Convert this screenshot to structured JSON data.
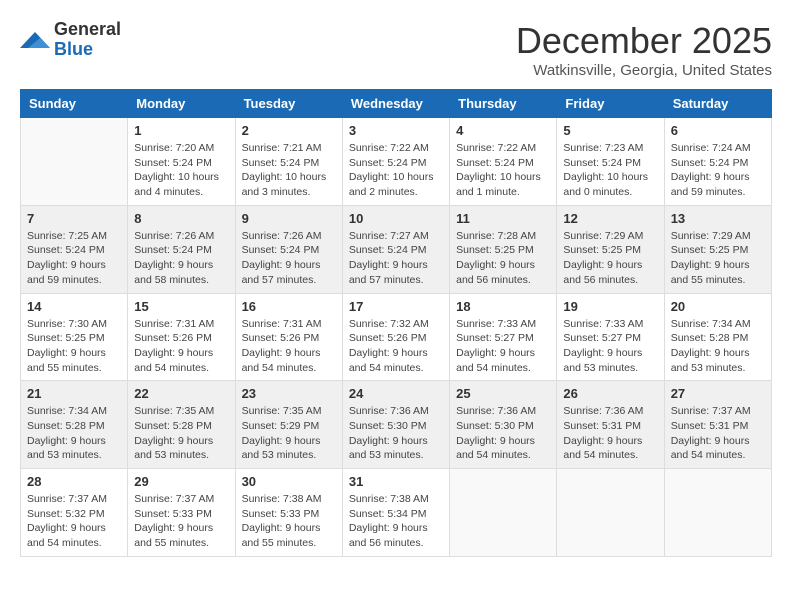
{
  "logo": {
    "general": "General",
    "blue": "Blue"
  },
  "title": "December 2025",
  "location": "Watkinsville, Georgia, United States",
  "weekdays": [
    "Sunday",
    "Monday",
    "Tuesday",
    "Wednesday",
    "Thursday",
    "Friday",
    "Saturday"
  ],
  "weeks": [
    [
      {
        "day": "",
        "empty": true
      },
      {
        "day": "1",
        "sunrise": "Sunrise: 7:20 AM",
        "sunset": "Sunset: 5:24 PM",
        "daylight": "Daylight: 10 hours and 4 minutes."
      },
      {
        "day": "2",
        "sunrise": "Sunrise: 7:21 AM",
        "sunset": "Sunset: 5:24 PM",
        "daylight": "Daylight: 10 hours and 3 minutes."
      },
      {
        "day": "3",
        "sunrise": "Sunrise: 7:22 AM",
        "sunset": "Sunset: 5:24 PM",
        "daylight": "Daylight: 10 hours and 2 minutes."
      },
      {
        "day": "4",
        "sunrise": "Sunrise: 7:22 AM",
        "sunset": "Sunset: 5:24 PM",
        "daylight": "Daylight: 10 hours and 1 minute."
      },
      {
        "day": "5",
        "sunrise": "Sunrise: 7:23 AM",
        "sunset": "Sunset: 5:24 PM",
        "daylight": "Daylight: 10 hours and 0 minutes."
      },
      {
        "day": "6",
        "sunrise": "Sunrise: 7:24 AM",
        "sunset": "Sunset: 5:24 PM",
        "daylight": "Daylight: 9 hours and 59 minutes."
      }
    ],
    [
      {
        "day": "7",
        "sunrise": "Sunrise: 7:25 AM",
        "sunset": "Sunset: 5:24 PM",
        "daylight": "Daylight: 9 hours and 59 minutes."
      },
      {
        "day": "8",
        "sunrise": "Sunrise: 7:26 AM",
        "sunset": "Sunset: 5:24 PM",
        "daylight": "Daylight: 9 hours and 58 minutes."
      },
      {
        "day": "9",
        "sunrise": "Sunrise: 7:26 AM",
        "sunset": "Sunset: 5:24 PM",
        "daylight": "Daylight: 9 hours and 57 minutes."
      },
      {
        "day": "10",
        "sunrise": "Sunrise: 7:27 AM",
        "sunset": "Sunset: 5:24 PM",
        "daylight": "Daylight: 9 hours and 57 minutes."
      },
      {
        "day": "11",
        "sunrise": "Sunrise: 7:28 AM",
        "sunset": "Sunset: 5:25 PM",
        "daylight": "Daylight: 9 hours and 56 minutes."
      },
      {
        "day": "12",
        "sunrise": "Sunrise: 7:29 AM",
        "sunset": "Sunset: 5:25 PM",
        "daylight": "Daylight: 9 hours and 56 minutes."
      },
      {
        "day": "13",
        "sunrise": "Sunrise: 7:29 AM",
        "sunset": "Sunset: 5:25 PM",
        "daylight": "Daylight: 9 hours and 55 minutes."
      }
    ],
    [
      {
        "day": "14",
        "sunrise": "Sunrise: 7:30 AM",
        "sunset": "Sunset: 5:25 PM",
        "daylight": "Daylight: 9 hours and 55 minutes."
      },
      {
        "day": "15",
        "sunrise": "Sunrise: 7:31 AM",
        "sunset": "Sunset: 5:26 PM",
        "daylight": "Daylight: 9 hours and 54 minutes."
      },
      {
        "day": "16",
        "sunrise": "Sunrise: 7:31 AM",
        "sunset": "Sunset: 5:26 PM",
        "daylight": "Daylight: 9 hours and 54 minutes."
      },
      {
        "day": "17",
        "sunrise": "Sunrise: 7:32 AM",
        "sunset": "Sunset: 5:26 PM",
        "daylight": "Daylight: 9 hours and 54 minutes."
      },
      {
        "day": "18",
        "sunrise": "Sunrise: 7:33 AM",
        "sunset": "Sunset: 5:27 PM",
        "daylight": "Daylight: 9 hours and 54 minutes."
      },
      {
        "day": "19",
        "sunrise": "Sunrise: 7:33 AM",
        "sunset": "Sunset: 5:27 PM",
        "daylight": "Daylight: 9 hours and 53 minutes."
      },
      {
        "day": "20",
        "sunrise": "Sunrise: 7:34 AM",
        "sunset": "Sunset: 5:28 PM",
        "daylight": "Daylight: 9 hours and 53 minutes."
      }
    ],
    [
      {
        "day": "21",
        "sunrise": "Sunrise: 7:34 AM",
        "sunset": "Sunset: 5:28 PM",
        "daylight": "Daylight: 9 hours and 53 minutes."
      },
      {
        "day": "22",
        "sunrise": "Sunrise: 7:35 AM",
        "sunset": "Sunset: 5:28 PM",
        "daylight": "Daylight: 9 hours and 53 minutes."
      },
      {
        "day": "23",
        "sunrise": "Sunrise: 7:35 AM",
        "sunset": "Sunset: 5:29 PM",
        "daylight": "Daylight: 9 hours and 53 minutes."
      },
      {
        "day": "24",
        "sunrise": "Sunrise: 7:36 AM",
        "sunset": "Sunset: 5:30 PM",
        "daylight": "Daylight: 9 hours and 53 minutes."
      },
      {
        "day": "25",
        "sunrise": "Sunrise: 7:36 AM",
        "sunset": "Sunset: 5:30 PM",
        "daylight": "Daylight: 9 hours and 54 minutes."
      },
      {
        "day": "26",
        "sunrise": "Sunrise: 7:36 AM",
        "sunset": "Sunset: 5:31 PM",
        "daylight": "Daylight: 9 hours and 54 minutes."
      },
      {
        "day": "27",
        "sunrise": "Sunrise: 7:37 AM",
        "sunset": "Sunset: 5:31 PM",
        "daylight": "Daylight: 9 hours and 54 minutes."
      }
    ],
    [
      {
        "day": "28",
        "sunrise": "Sunrise: 7:37 AM",
        "sunset": "Sunset: 5:32 PM",
        "daylight": "Daylight: 9 hours and 54 minutes."
      },
      {
        "day": "29",
        "sunrise": "Sunrise: 7:37 AM",
        "sunset": "Sunset: 5:33 PM",
        "daylight": "Daylight: 9 hours and 55 minutes."
      },
      {
        "day": "30",
        "sunrise": "Sunrise: 7:38 AM",
        "sunset": "Sunset: 5:33 PM",
        "daylight": "Daylight: 9 hours and 55 minutes."
      },
      {
        "day": "31",
        "sunrise": "Sunrise: 7:38 AM",
        "sunset": "Sunset: 5:34 PM",
        "daylight": "Daylight: 9 hours and 56 minutes."
      },
      {
        "day": "",
        "empty": true
      },
      {
        "day": "",
        "empty": true
      },
      {
        "day": "",
        "empty": true
      }
    ]
  ]
}
